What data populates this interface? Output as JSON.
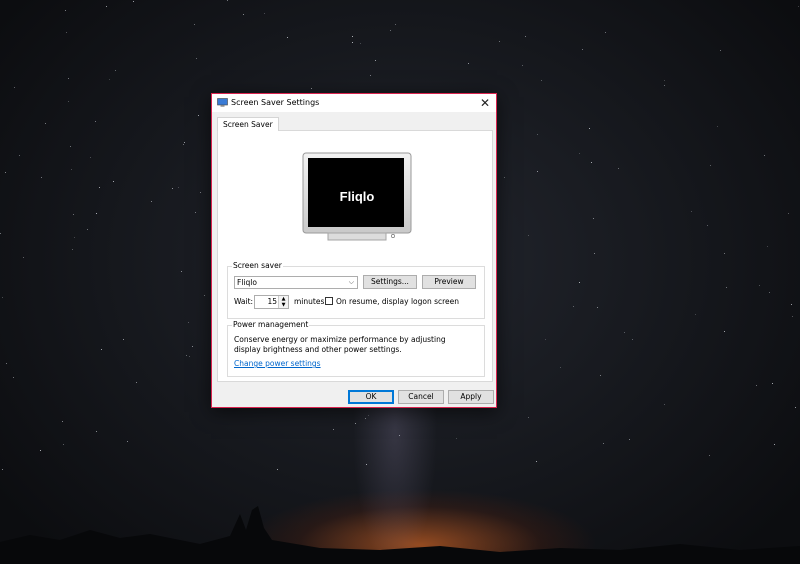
{
  "window": {
    "title": "Screen Saver Settings",
    "close_glyph": "✕",
    "accent_border": "#d9244f",
    "icon": "screen-saver-app-icon"
  },
  "tabs": [
    {
      "label": "Screen Saver",
      "selected": true
    }
  ],
  "preview": {
    "text": "Fliqlo"
  },
  "screen_saver": {
    "group_label": "Screen saver",
    "selected": "Fliqlo",
    "settings_label": "Settings...",
    "preview_label": "Preview",
    "wait_label": "Wait:",
    "wait_value": "15",
    "minutes_label": "minutes",
    "resume_label": "On resume, display logon screen",
    "resume_checked": false
  },
  "power": {
    "group_label": "Power management",
    "description": "Conserve energy or maximize performance by adjusting display brightness and other power settings.",
    "link": "Change power settings",
    "link_color": "#0066cc"
  },
  "buttons": {
    "ok": "OK",
    "cancel": "Cancel",
    "apply": "Apply"
  }
}
